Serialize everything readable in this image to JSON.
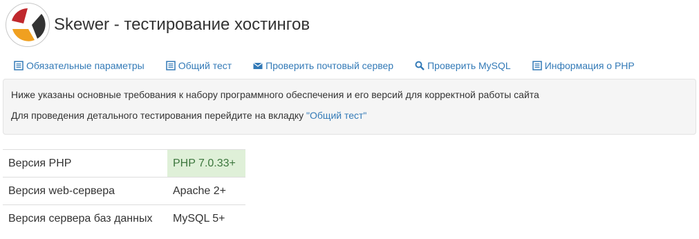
{
  "header": {
    "title": "Skewer - тестирование хостингов",
    "logo_colors": {
      "red": "#c0282d",
      "orange": "#f0a020",
      "dark": "#333333"
    }
  },
  "nav": {
    "items": [
      {
        "label": "Обязательные параметры",
        "icon": "list-alt-icon"
      },
      {
        "label": "Общий тест",
        "icon": "list-alt-icon"
      },
      {
        "label": "Проверить почтовый сервер",
        "icon": "envelope-icon"
      },
      {
        "label": "Проверить MySQL",
        "icon": "search-icon"
      },
      {
        "label": "Информация о PHP",
        "icon": "list-alt-icon"
      }
    ]
  },
  "info": {
    "line1": "Ниже указаны основные требования к набору программного обеспечения и его версий для корректной работы сайта",
    "line2_prefix": "Для проведения детального тестирования перейдите на вкладку ",
    "line2_link": "\"Общий тест\""
  },
  "requirements": [
    {
      "name": "Версия PHP",
      "value": "PHP 7.0.33+",
      "status": "ok"
    },
    {
      "name": "Версия web-сервера",
      "value": "Apache 2+",
      "status": ""
    },
    {
      "name": "Версия сервера баз данных",
      "value": "MySQL 5+",
      "status": ""
    }
  ],
  "colors": {
    "link": "#337ab7",
    "success_bg": "#dff0d8",
    "success_text": "#3c763d"
  }
}
